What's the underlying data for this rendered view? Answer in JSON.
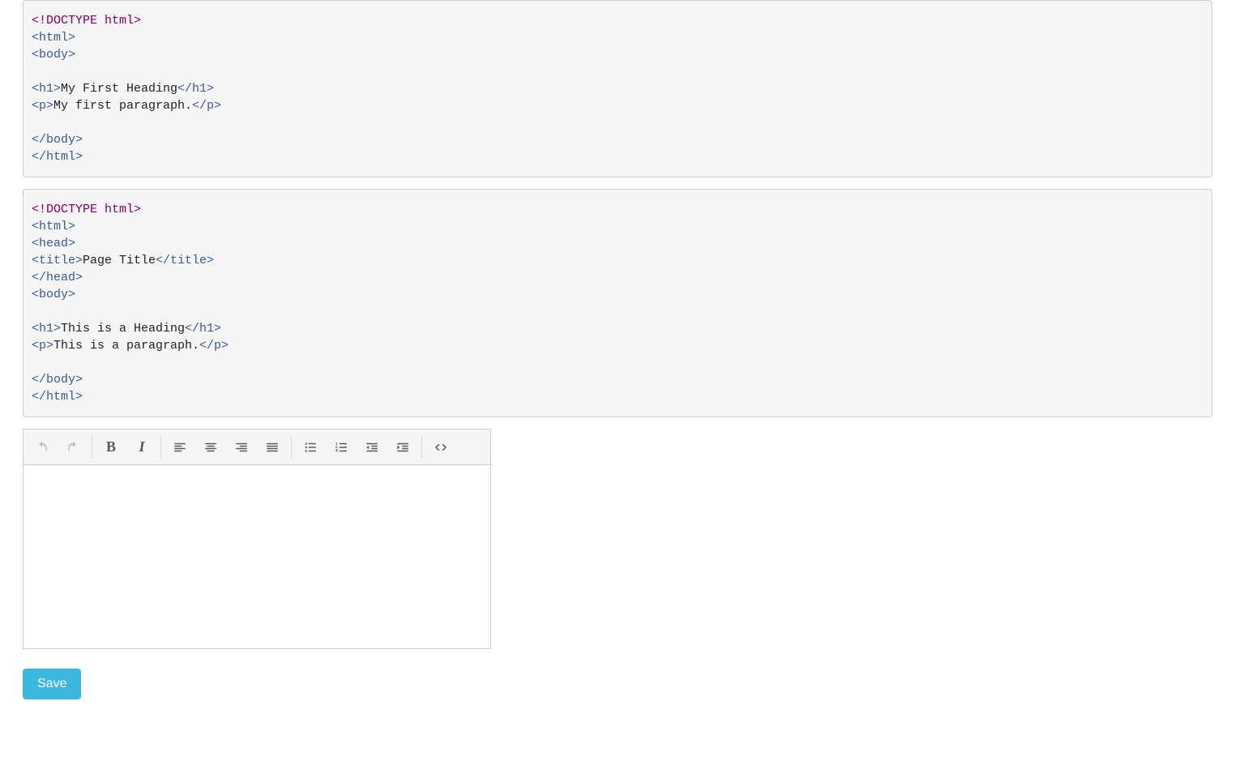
{
  "code_block_1": {
    "lines": [
      {
        "parts": [
          {
            "type": "doctype",
            "text": "<!DOCTYPE html>"
          }
        ]
      },
      {
        "parts": [
          {
            "type": "tag",
            "text": "<html>"
          }
        ]
      },
      {
        "parts": [
          {
            "type": "tag",
            "text": "<body>"
          }
        ]
      },
      {
        "parts": []
      },
      {
        "parts": [
          {
            "type": "tag",
            "text": "<h1>"
          },
          {
            "type": "txt",
            "text": "My First Heading"
          },
          {
            "type": "tag",
            "text": "</h1>"
          }
        ]
      },
      {
        "parts": [
          {
            "type": "tag",
            "text": "<p>"
          },
          {
            "type": "txt",
            "text": "My first paragraph."
          },
          {
            "type": "tag",
            "text": "</p>"
          }
        ]
      },
      {
        "parts": []
      },
      {
        "parts": [
          {
            "type": "tag",
            "text": "</body>"
          }
        ]
      },
      {
        "parts": [
          {
            "type": "tag",
            "text": "</html>"
          }
        ]
      }
    ]
  },
  "code_block_2": {
    "lines": [
      {
        "parts": [
          {
            "type": "doctype",
            "text": "<!DOCTYPE html>"
          }
        ]
      },
      {
        "parts": [
          {
            "type": "tag",
            "text": "<html>"
          }
        ]
      },
      {
        "parts": [
          {
            "type": "tag",
            "text": "<head>"
          }
        ]
      },
      {
        "parts": [
          {
            "type": "tag",
            "text": "<title>"
          },
          {
            "type": "txt",
            "text": "Page Title"
          },
          {
            "type": "tag",
            "text": "</title>"
          }
        ]
      },
      {
        "parts": [
          {
            "type": "tag",
            "text": "</head>"
          }
        ]
      },
      {
        "parts": [
          {
            "type": "tag",
            "text": "<body>"
          }
        ]
      },
      {
        "parts": []
      },
      {
        "parts": [
          {
            "type": "tag",
            "text": "<h1>"
          },
          {
            "type": "txt",
            "text": "This is a Heading"
          },
          {
            "type": "tag",
            "text": "</h1>"
          }
        ]
      },
      {
        "parts": [
          {
            "type": "tag",
            "text": "<p>"
          },
          {
            "type": "txt",
            "text": "This is a paragraph."
          },
          {
            "type": "tag",
            "text": "</p>"
          }
        ]
      },
      {
        "parts": []
      },
      {
        "parts": [
          {
            "type": "tag",
            "text": "</body>"
          }
        ]
      },
      {
        "parts": [
          {
            "type": "tag",
            "text": "</html>"
          }
        ]
      }
    ]
  },
  "toolbar": {
    "undo": "Undo",
    "redo": "Redo",
    "bold": "Bold",
    "italic": "Italic",
    "align_left": "Align left",
    "align_center": "Align center",
    "align_right": "Align right",
    "justify": "Justify",
    "bullets": "Bulleted list",
    "numbers": "Numbered list",
    "outdent": "Decrease indent",
    "indent": "Increase indent",
    "code": "Source code"
  },
  "save_label": "Save"
}
